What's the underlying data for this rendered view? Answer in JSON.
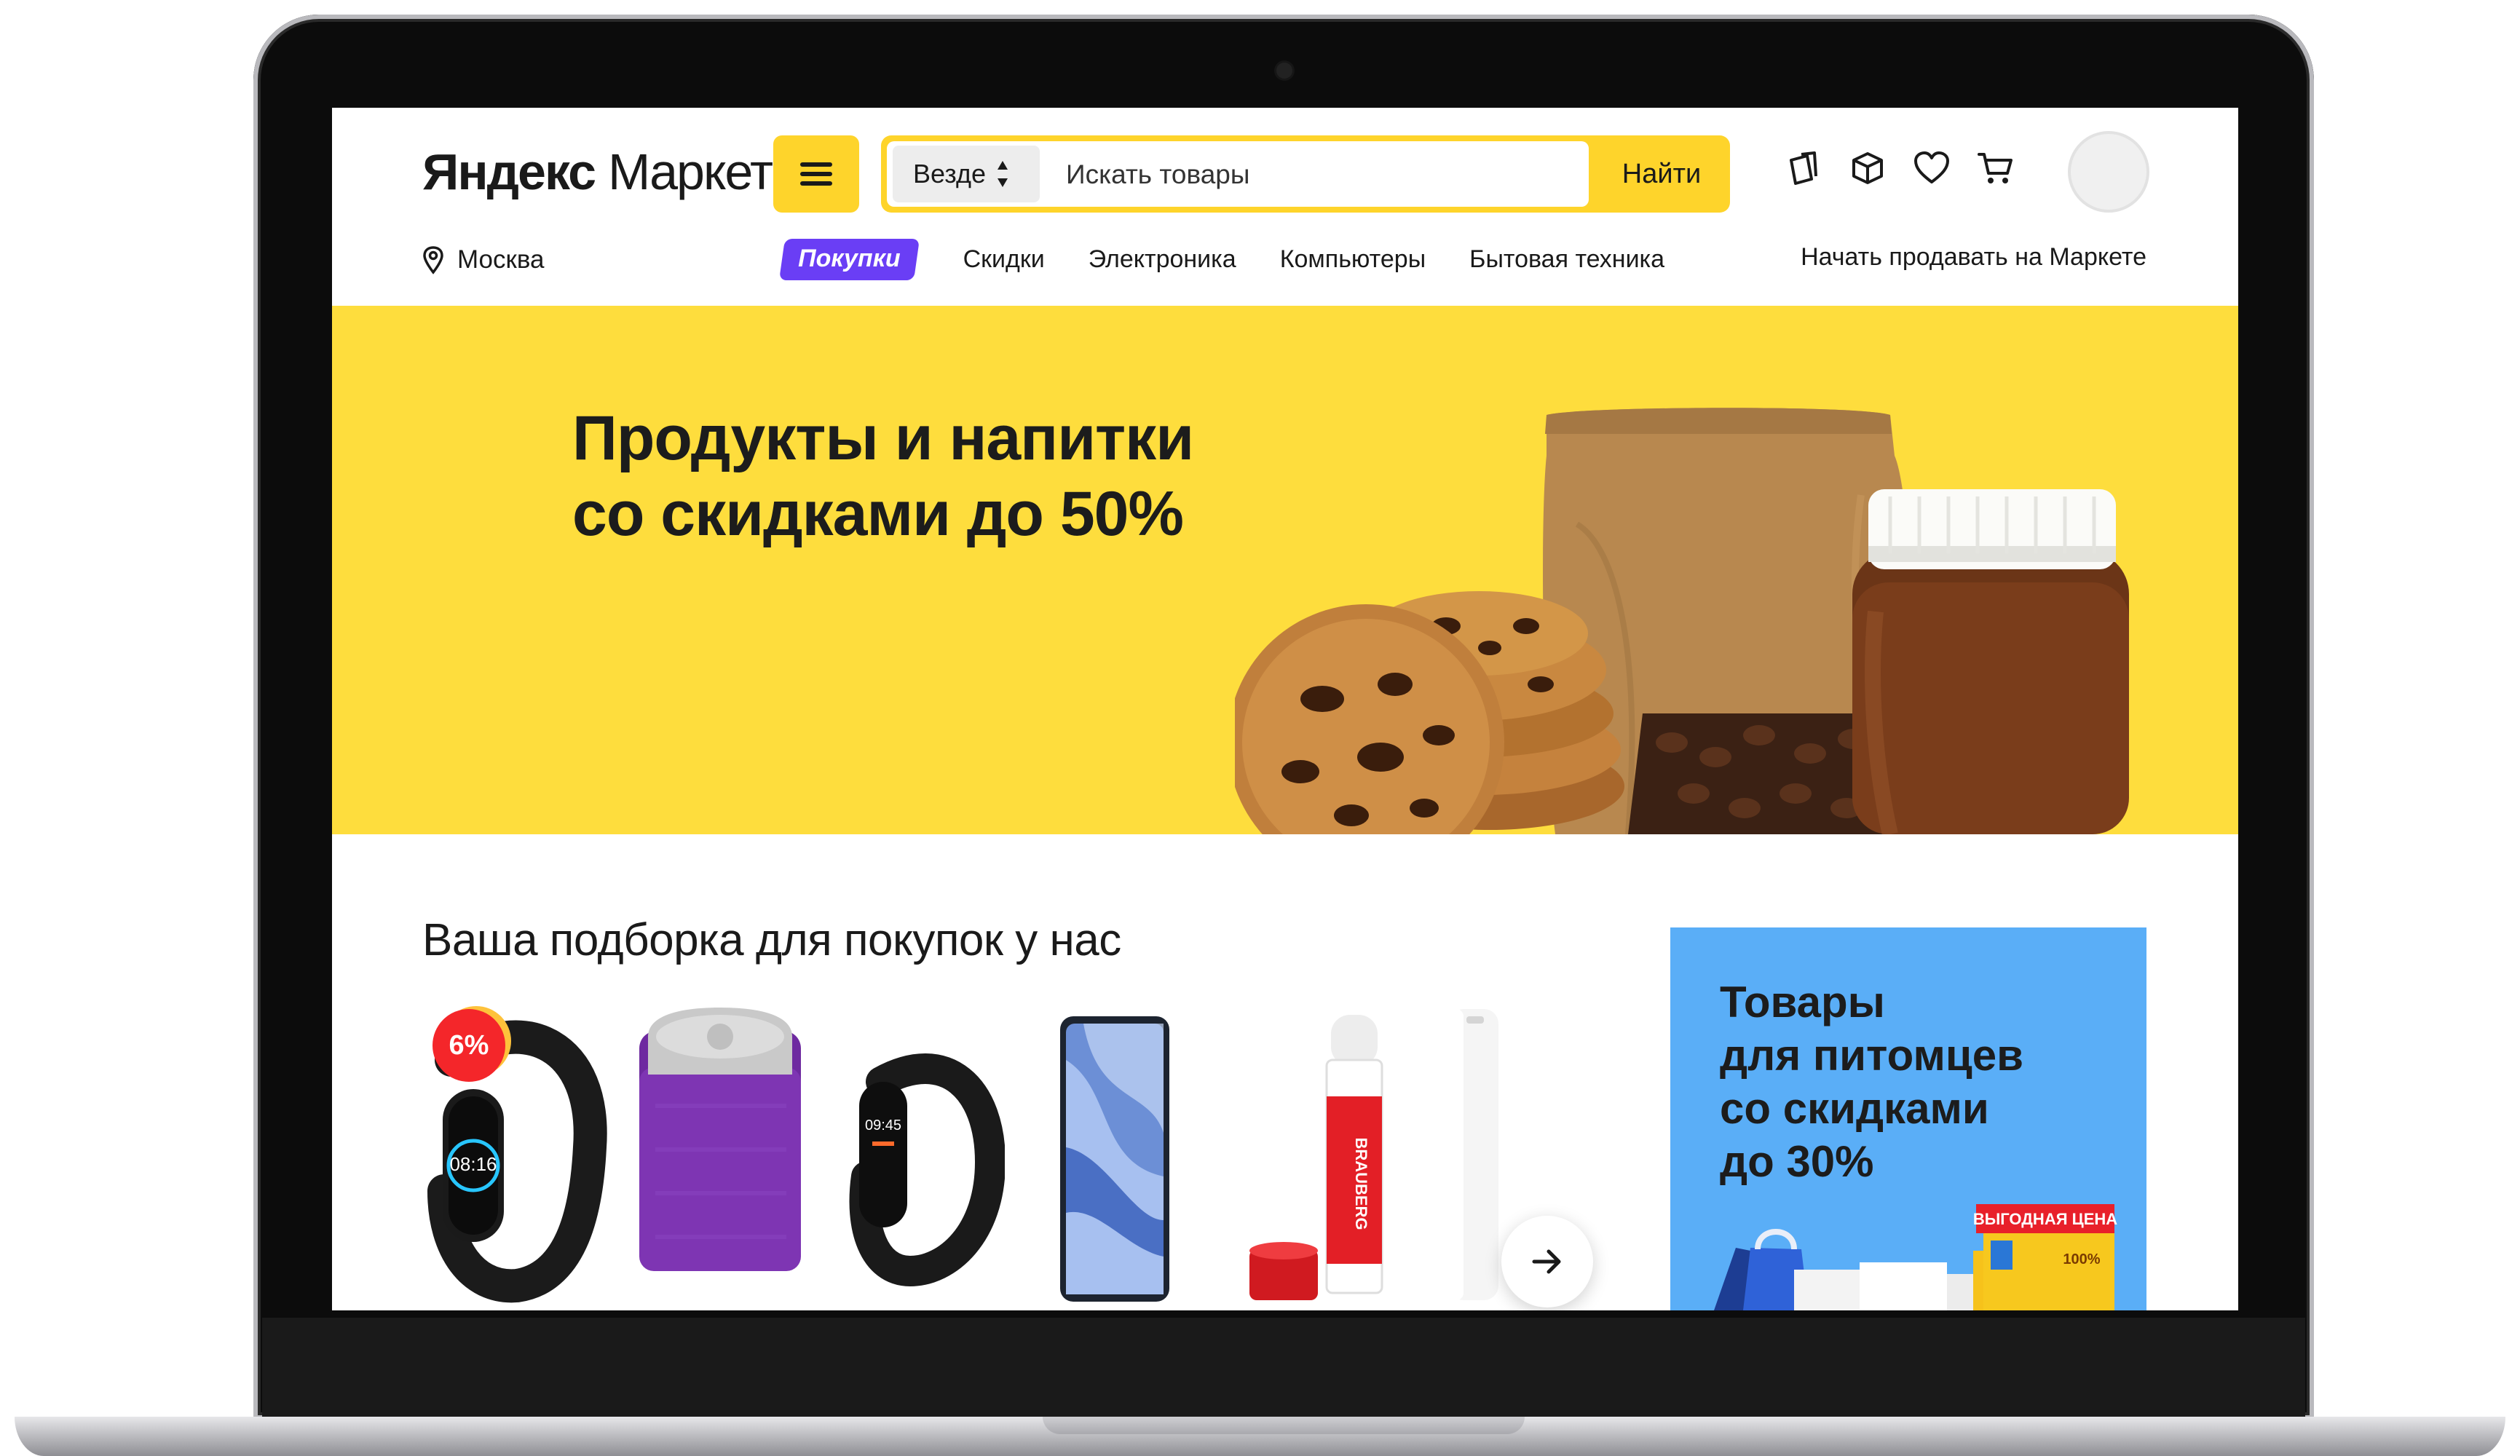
{
  "header": {
    "logo": {
      "brand": "Яндекс",
      "product": "Маркет"
    },
    "search": {
      "scope_label": "Везде",
      "placeholder": "Искать товары",
      "submit_label": "Найти"
    },
    "icons": [
      "orders-icon",
      "box-icon",
      "heart-icon",
      "cart-icon"
    ],
    "location": "Москва",
    "nav": {
      "promo_label": "Покупки",
      "items": [
        "Скидки",
        "Электроника",
        "Компьютеры",
        "Бытовая техника"
      ]
    },
    "sell_link": "Начать продавать на Маркете"
  },
  "hero": {
    "title_line1": "Продукты и напитки",
    "title_line2": "со скидками до 50%"
  },
  "selection": {
    "title": "Ваша подборка для покупок у нас",
    "products": [
      {
        "name": "fitness-band",
        "badge": "6%",
        "screen_time": "08:16"
      },
      {
        "name": "smart-speaker"
      },
      {
        "name": "fitness-band-2",
        "screen_time": "09:45"
      },
      {
        "name": "smartphone"
      },
      {
        "name": "glue-stick",
        "brand": "BRAUBERG"
      },
      {
        "name": "power-bank"
      }
    ]
  },
  "pet_promo": {
    "line1": "Товары",
    "line2": "для питомцев",
    "line3": "со скидками",
    "line4": "до 30%",
    "tag": "ВЫГОДНАЯ ЦЕНА",
    "tag_sub": "100%"
  },
  "colors": {
    "brand_yellow": "#fed42b",
    "hero_yellow": "#fedd3d",
    "promo_purple": "#6a3ef5",
    "pet_blue": "#5aaef7",
    "badge_red": "#f4262a"
  }
}
